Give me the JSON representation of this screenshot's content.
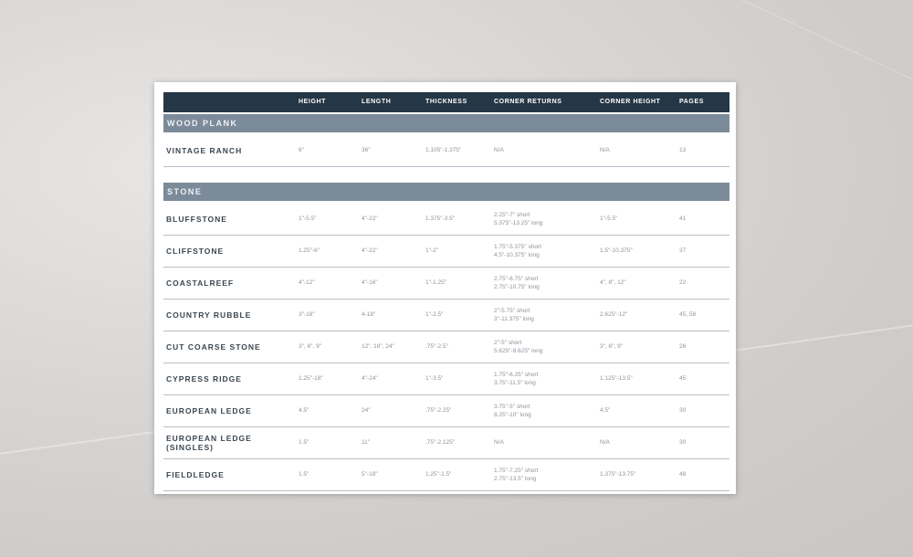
{
  "headers": [
    "HEIGHT",
    "LENGTH",
    "THICKNESS",
    "CORNER RETURNS",
    "CORNER HEIGHT",
    "PAGES"
  ],
  "sections": [
    {
      "title": "WOOD PLANK",
      "rows": [
        {
          "name": "VINTAGE RANCH",
          "height": "6\"",
          "length": "36\"",
          "thickness": "1.105\"-1.375\"",
          "corner_returns": [
            "N/A"
          ],
          "corner_height": "N/A",
          "pages": "13"
        }
      ]
    },
    {
      "title": "STONE",
      "rows": [
        {
          "name": "BLUFFSTONE",
          "height": "1\"-5.5\"",
          "length": "4\"-22\"",
          "thickness": "1.375\"-3.5\"",
          "corner_returns": [
            "2.25\"-7\" short",
            "5.375\"-13.25\" long"
          ],
          "corner_height": "1\"-5.5\"",
          "pages": "41"
        },
        {
          "name": "CLIFFSTONE",
          "height": "1.25\"-6\"",
          "length": "4\"-22\"",
          "thickness": "1\"-2\"",
          "corner_returns": [
            "1.75\"-5.375\" short",
            "4.5\"-10.375\" long"
          ],
          "corner_height": "1.5\"-10.375\"",
          "pages": "37"
        },
        {
          "name": "COASTALREEF",
          "height": "4\"-12\"",
          "length": "4\"-16\"",
          "thickness": "1\"-1.25\"",
          "corner_returns": [
            "2.75\"-6.75\" short",
            "2.75\"-10.75\" long"
          ],
          "corner_height": "4\", 8\", 12\"",
          "pages": "22"
        },
        {
          "name": "COUNTRY RUBBLE",
          "height": "3\"-18\"",
          "length": "4-18\"",
          "thickness": "1\"-2.5\"",
          "corner_returns": [
            "2\"-5.75\" short",
            "3\"-11.375\" long"
          ],
          "corner_height": "2.625\"-12\"",
          "pages": "45, 58"
        },
        {
          "name": "CUT COARSE STONE",
          "height": "3\", 6\", 9\"",
          "length": "12\", 18\", 24\"",
          "thickness": ".75\"-2.5\"",
          "corner_returns": [
            "2\"-5\" short",
            "5.625\"-9.625\" long"
          ],
          "corner_height": "3\", 6\", 9\"",
          "pages": "26"
        },
        {
          "name": "CYPRESS RIDGE",
          "height": "1.25\"-18\"",
          "length": "4\"-24\"",
          "thickness": "1\"-3.5\"",
          "corner_returns": [
            "1.75\"-6.25\" short",
            "3.75\"-11.5\" long"
          ],
          "corner_height": "1.125\"-13.5\"",
          "pages": "45"
        },
        {
          "name": "EUROPEAN LEDGE",
          "height": "4.5\"",
          "length": "24\"",
          "thickness": ".75\"-2.25\"",
          "corner_returns": [
            "3.75\"-5\" short",
            "8.25\"-10\" long"
          ],
          "corner_height": "4.5\"",
          "pages": "30"
        },
        {
          "name": "EUROPEAN LEDGE (SINGLES)",
          "name_lines": [
            "EUROPEAN LEDGE",
            "(SINGLES)"
          ],
          "height": "1.5\"",
          "length": "11\"",
          "thickness": ".75\"-2.125\"",
          "corner_returns": [
            "N/A"
          ],
          "corner_height": "N/A",
          "pages": "30"
        },
        {
          "name": "FIELDLEDGE",
          "height": "1.5\"",
          "length": "5\"-18\"",
          "thickness": "1.25\"-1.5\"",
          "corner_returns": [
            "1.75\"-7.25\" short",
            "2.75\"-13.5\" long"
          ],
          "corner_height": "1.375\"-13.75\"",
          "pages": "48"
        }
      ]
    }
  ]
}
